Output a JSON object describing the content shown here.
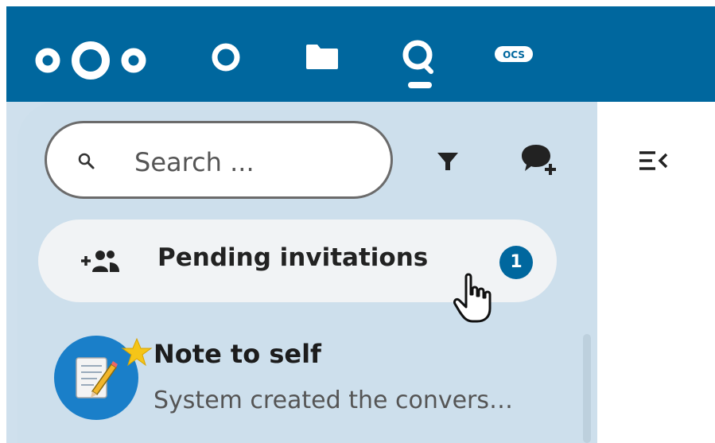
{
  "topbar": {
    "bg_color": "#00679e",
    "apps": [
      {
        "name": "nextcloud-logo",
        "icon": "nextcloud-logo"
      },
      {
        "name": "dashboard",
        "icon": "circle-icon"
      },
      {
        "name": "files",
        "icon": "folder-icon"
      },
      {
        "name": "talk",
        "icon": "talk-icon",
        "active": true
      },
      {
        "name": "ocs",
        "icon": "ocs-icon",
        "label": "OCS"
      }
    ]
  },
  "sidebar": {
    "bg_color": "#cddfec",
    "search": {
      "placeholder": "Search ..."
    },
    "filter_icon": "filter-icon",
    "new_conversation_icon": "new-conversation-icon",
    "pending": {
      "label": "Pending invitations",
      "count": "1"
    },
    "conversations": [
      {
        "title": "Note to self",
        "subtitle": "System created the convers…",
        "favorite": true
      }
    ]
  },
  "main": {
    "toggle_icon": "close-sidebar-icon"
  }
}
